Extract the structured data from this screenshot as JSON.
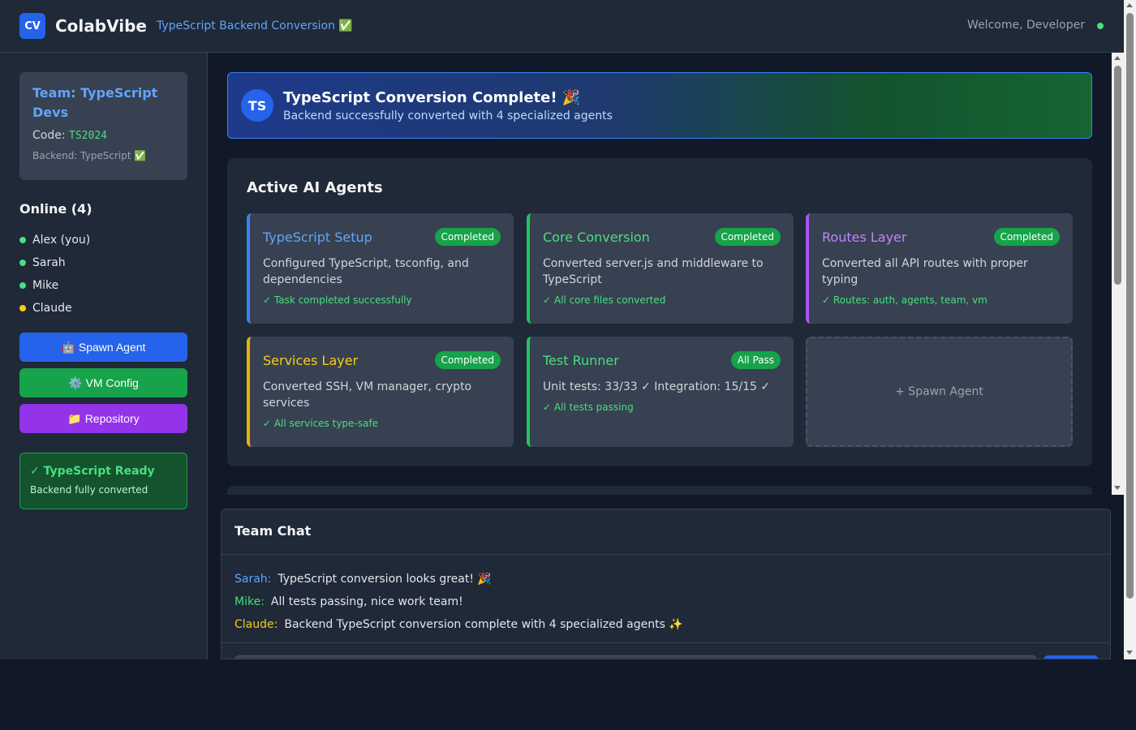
{
  "header": {
    "logo": "CV",
    "app_name": "ColabVibe",
    "subtitle": "TypeScript Backend Conversion ✅",
    "welcome": "Welcome, Developer",
    "status_color": "#4ade80"
  },
  "sidebar": {
    "team": {
      "name": "Team: TypeScript Devs",
      "code_label": "Code: ",
      "code": "TS2024",
      "backend": "Backend: TypeScript ✅"
    },
    "online_title": "Online (4)",
    "users": [
      {
        "name": "Alex (you)",
        "status": "online",
        "color": "#4ade80"
      },
      {
        "name": "Sarah",
        "status": "online",
        "color": "#4ade80"
      },
      {
        "name": "Mike",
        "status": "online",
        "color": "#4ade80"
      },
      {
        "name": "Claude",
        "status": "away",
        "color": "#facc15"
      }
    ],
    "buttons": {
      "spawn_agent": "🤖 Spawn Agent",
      "vm_config": "⚙️ VM Config",
      "repository": "📁 Repository"
    },
    "ready": {
      "title": "✓  TypeScript Ready",
      "subtitle": "Backend fully converted"
    }
  },
  "banner": {
    "badge": "TS",
    "title": "TypeScript Conversion Complete! 🎉",
    "subtitle": "Backend successfully converted with 4 specialized agents"
  },
  "agents": {
    "title": "Active AI Agents",
    "items": [
      {
        "name": "TypeScript Setup",
        "badge": "Completed",
        "desc": "Configured TypeScript, tsconfig, and dependencies",
        "status": "✓ Task completed successfully",
        "color": "#60a5fa",
        "border": "#3b82f6"
      },
      {
        "name": "Core Conversion",
        "badge": "Completed",
        "desc": "Converted server.js and middleware to TypeScript",
        "status": "✓ All core files converted",
        "color": "#4ade80",
        "border": "#22c55e"
      },
      {
        "name": "Routes Layer",
        "badge": "Completed",
        "desc": "Converted all API routes with proper typing",
        "status": "✓ Routes: auth, agents, team, vm",
        "color": "#c084fc",
        "border": "#a855f7"
      },
      {
        "name": "Services Layer",
        "badge": "Completed",
        "desc": "Converted SSH, VM manager, crypto services",
        "status": "✓ All services type-safe",
        "color": "#facc15",
        "border": "#eab308"
      },
      {
        "name": "Test Runner",
        "badge": "All Pass",
        "desc": "Unit tests: 33/33 ✓ Integration: 15/15 ✓",
        "status": "✓ All tests passing",
        "color": "#4ade80",
        "border": "#22c55e"
      }
    ],
    "spawn_label": "+  Spawn Agent"
  },
  "chat": {
    "title": "Team Chat",
    "messages": [
      {
        "author": "Sarah:",
        "text": "TypeScript conversion looks great! 🎉",
        "color": "#60a5fa"
      },
      {
        "author": "Mike:",
        "text": "All tests passing, nice work team!",
        "color": "#4ade80"
      },
      {
        "author": "Claude:",
        "text": "Backend TypeScript conversion complete with 4 specialized agents ✨",
        "color": "#facc15"
      }
    ]
  }
}
